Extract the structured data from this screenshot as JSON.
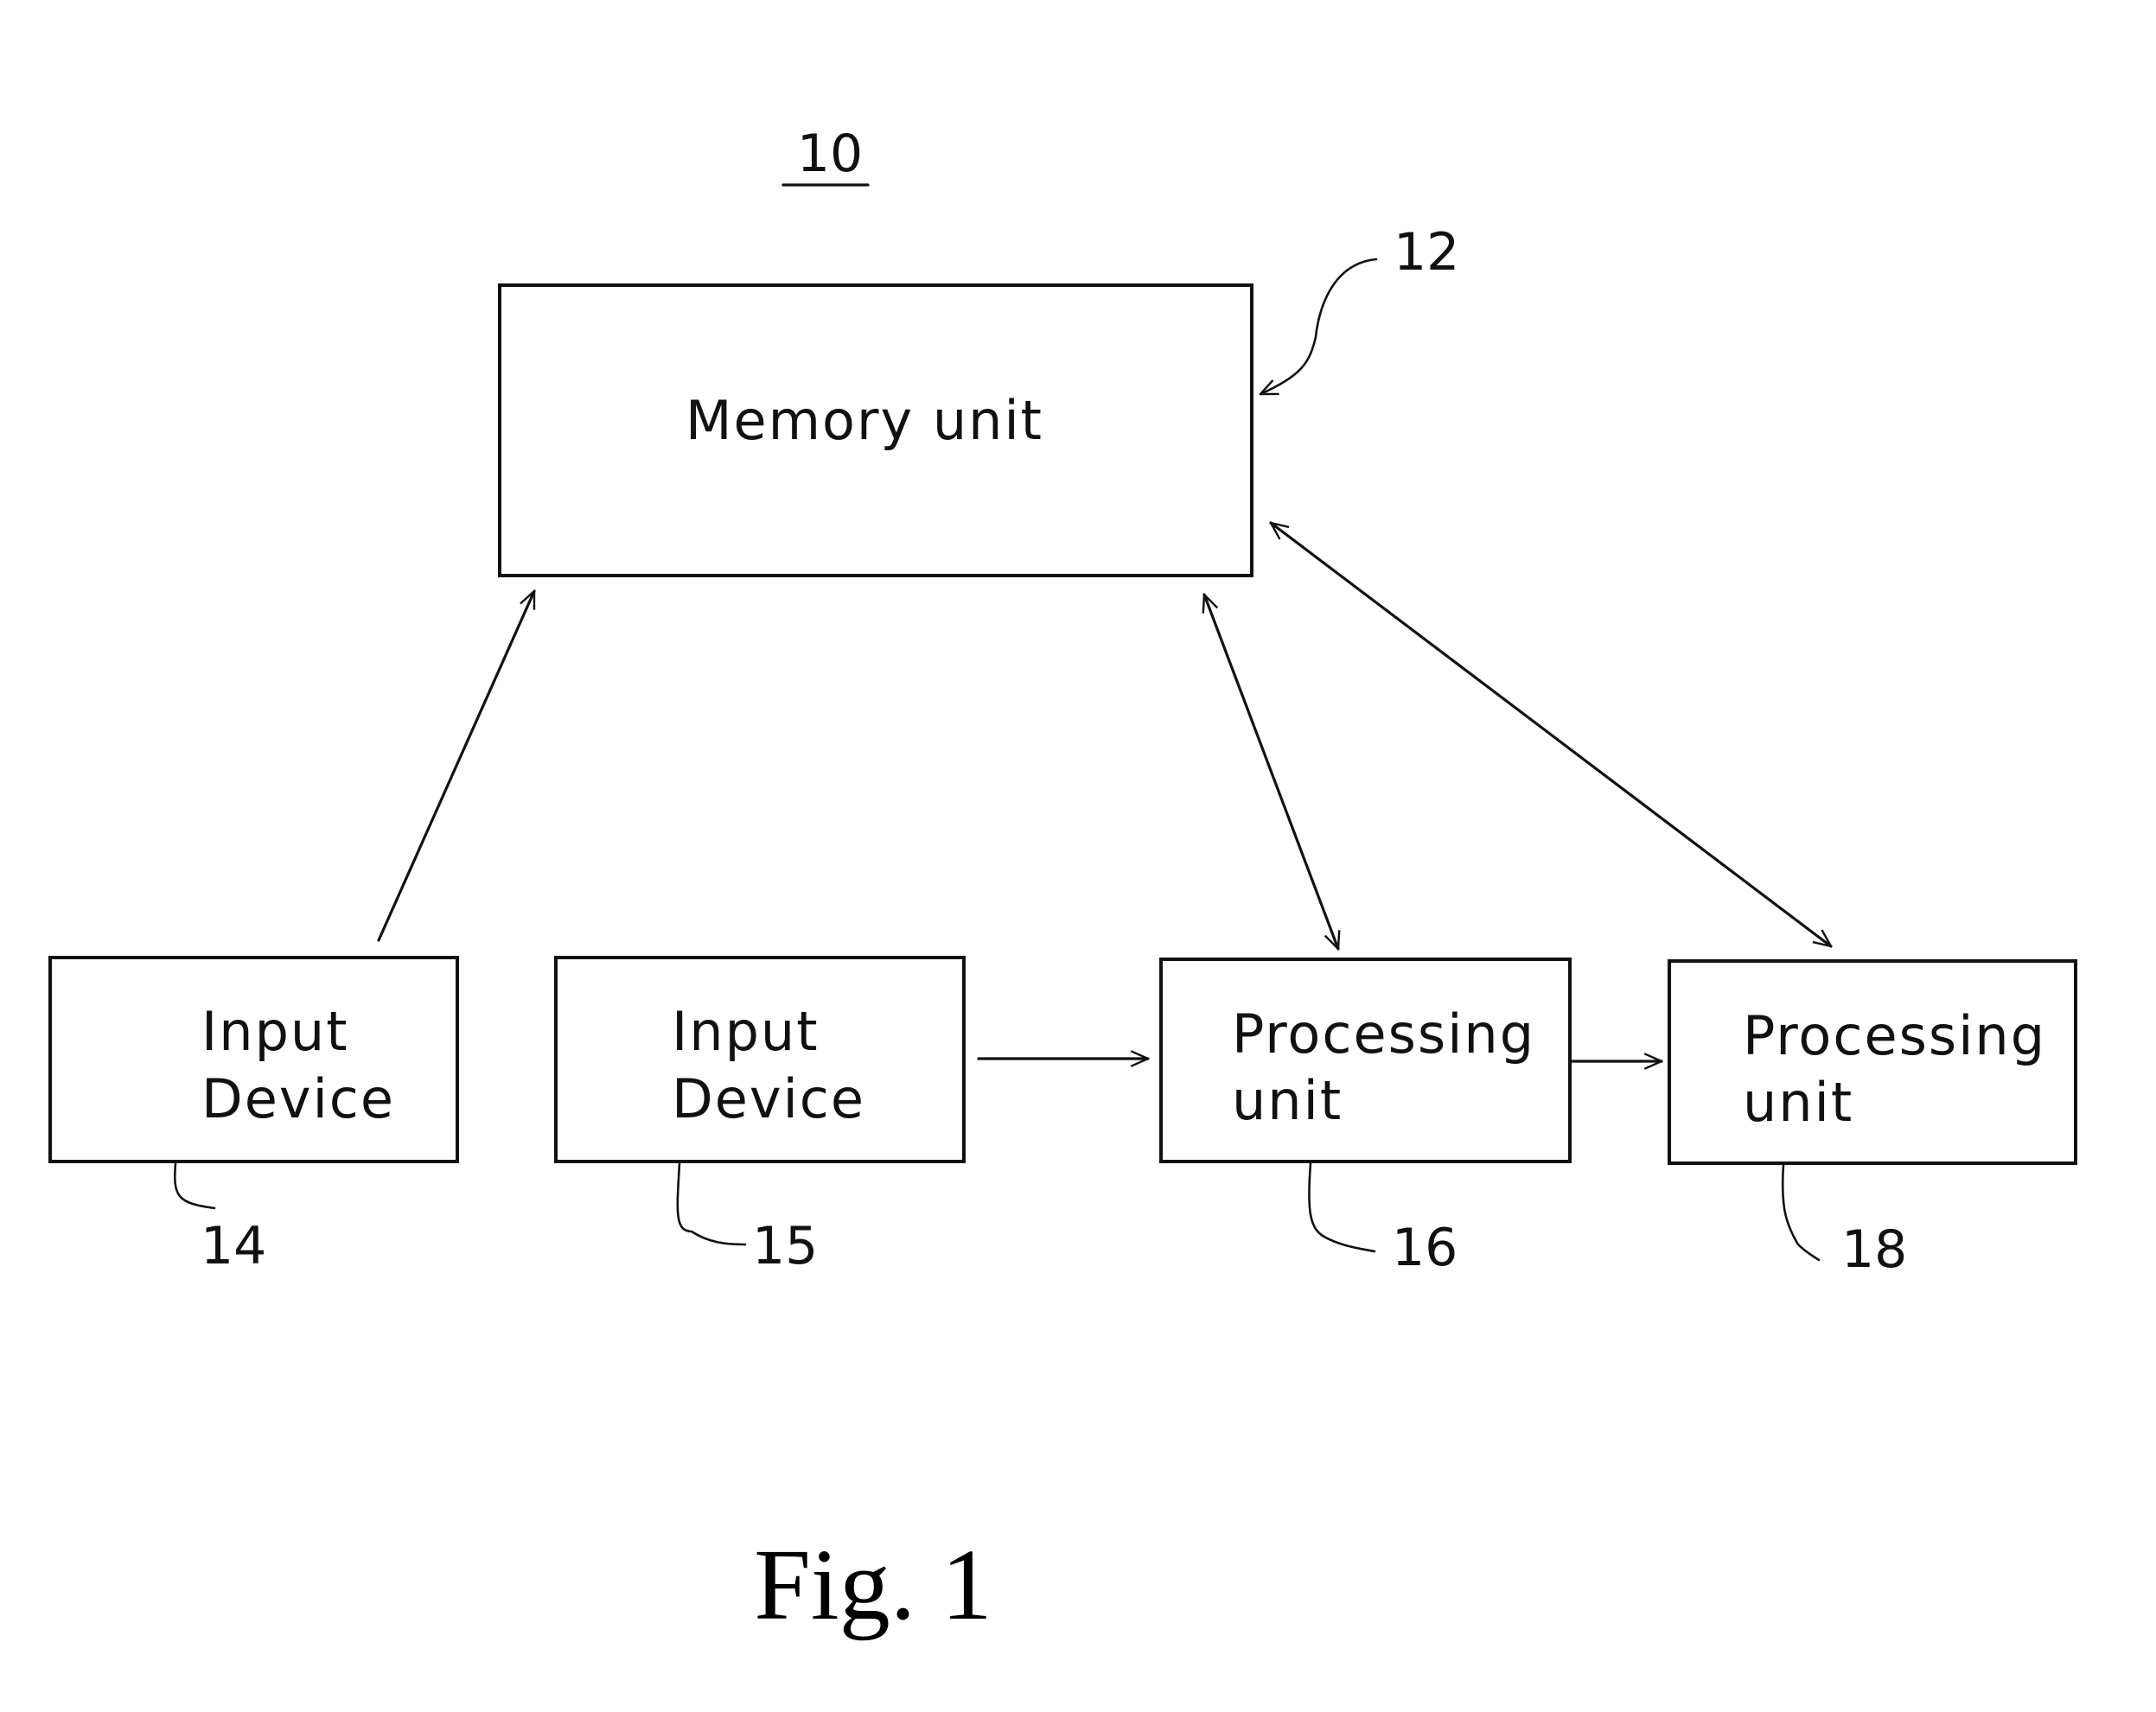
{
  "diagram": {
    "system_ref": "10",
    "figure_caption": "Fig. 1",
    "blocks": [
      {
        "id": "memory",
        "ref": "12",
        "lines": [
          "Memory unit"
        ]
      },
      {
        "id": "input1",
        "ref": "14",
        "lines": [
          "Input",
          "Device"
        ]
      },
      {
        "id": "input2",
        "ref": "15",
        "lines": [
          "Input",
          "Device"
        ]
      },
      {
        "id": "proc1",
        "ref": "16",
        "lines": [
          "Processing",
          "unit"
        ]
      },
      {
        "id": "proc2",
        "ref": "18",
        "lines": [
          "Processing",
          "unit"
        ]
      }
    ],
    "connections": [
      {
        "from": "input1",
        "to": "memory",
        "direction": "one-way"
      },
      {
        "from": "input2",
        "to": "proc1",
        "direction": "one-way"
      },
      {
        "from": "proc1",
        "to": "proc2",
        "direction": "one-way"
      },
      {
        "from": "memory",
        "to": "proc1",
        "direction": "two-way"
      },
      {
        "from": "memory",
        "to": "proc2",
        "direction": "two-way"
      }
    ]
  }
}
